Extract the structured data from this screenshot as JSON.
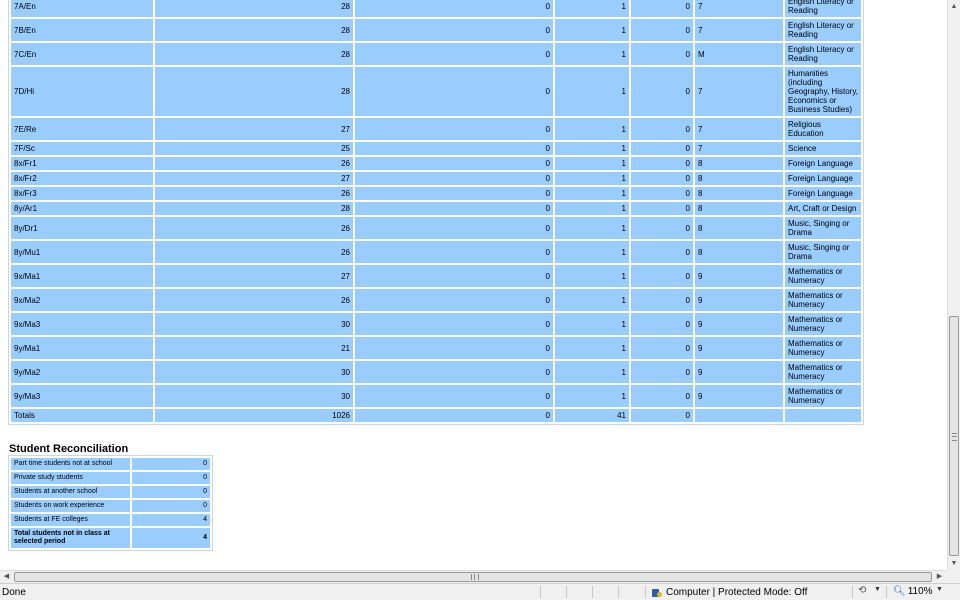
{
  "classes": {
    "rows": [
      {
        "cls": "7A/En",
        "size": "28",
        "c2": "0",
        "c3": "1",
        "c4": "0",
        "year": "7",
        "subject": "English Literacy or Reading"
      },
      {
        "cls": "7B/En",
        "size": "28",
        "c2": "0",
        "c3": "1",
        "c4": "0",
        "year": "7",
        "subject": "English Literacy or Reading"
      },
      {
        "cls": "7C/En",
        "size": "28",
        "c2": "0",
        "c3": "1",
        "c4": "0",
        "year": "M",
        "subject": "English Literacy or Reading"
      },
      {
        "cls": "7D/Hi",
        "size": "28",
        "c2": "0",
        "c3": "1",
        "c4": "0",
        "year": "7",
        "subject": "Humanities (including Geography, History, Economics or Business Studies)"
      },
      {
        "cls": "7E/Re",
        "size": "27",
        "c2": "0",
        "c3": "1",
        "c4": "0",
        "year": "7",
        "subject": "Religious Education"
      },
      {
        "cls": "7F/Sc",
        "size": "25",
        "c2": "0",
        "c3": "1",
        "c4": "0",
        "year": "7",
        "subject": "Science"
      },
      {
        "cls": "8x/Fr1",
        "size": "26",
        "c2": "0",
        "c3": "1",
        "c4": "0",
        "year": "8",
        "subject": "Foreign Language"
      },
      {
        "cls": "8x/Fr2",
        "size": "27",
        "c2": "0",
        "c3": "1",
        "c4": "0",
        "year": "8",
        "subject": "Foreign Language"
      },
      {
        "cls": "8x/Fr3",
        "size": "26",
        "c2": "0",
        "c3": "1",
        "c4": "0",
        "year": "8",
        "subject": "Foreign Language"
      },
      {
        "cls": "8y/Ar1",
        "size": "28",
        "c2": "0",
        "c3": "1",
        "c4": "0",
        "year": "8",
        "subject": "Art, Craft or Design"
      },
      {
        "cls": "8y/Dr1",
        "size": "26",
        "c2": "0",
        "c3": "1",
        "c4": "0",
        "year": "8",
        "subject": "Music, Singing or Drama"
      },
      {
        "cls": "8y/Mu1",
        "size": "26",
        "c2": "0",
        "c3": "1",
        "c4": "0",
        "year": "8",
        "subject": "Music, Singing or Drama"
      },
      {
        "cls": "9x/Ma1",
        "size": "27",
        "c2": "0",
        "c3": "1",
        "c4": "0",
        "year": "9",
        "subject": "Mathematics or Numeracy"
      },
      {
        "cls": "9x/Ma2",
        "size": "26",
        "c2": "0",
        "c3": "1",
        "c4": "0",
        "year": "9",
        "subject": "Mathematics or Numeracy"
      },
      {
        "cls": "9x/Ma3",
        "size": "30",
        "c2": "0",
        "c3": "1",
        "c4": "0",
        "year": "9",
        "subject": "Mathematics or Numeracy"
      },
      {
        "cls": "9y/Ma1",
        "size": "21",
        "c2": "0",
        "c3": "1",
        "c4": "0",
        "year": "9",
        "subject": "Mathematics or Numeracy"
      },
      {
        "cls": "9y/Ma2",
        "size": "30",
        "c2": "0",
        "c3": "1",
        "c4": "0",
        "year": "9",
        "subject": "Mathematics or Numeracy"
      },
      {
        "cls": "9y/Ma3",
        "size": "30",
        "c2": "0",
        "c3": "1",
        "c4": "0",
        "year": "9",
        "subject": "Mathematics or Numeracy"
      }
    ],
    "totals": {
      "label": "Totals",
      "size": "1026",
      "c2": "0",
      "c3": "41",
      "c4": "0",
      "year": "",
      "subject": ""
    }
  },
  "reconciliation": {
    "title": "Student Reconciliation",
    "rows": [
      {
        "label": "Part time students not at school",
        "value": "0"
      },
      {
        "label": "Private study students",
        "value": "0"
      },
      {
        "label": "Students at another school",
        "value": "0"
      },
      {
        "label": "Students on work experience",
        "value": "0"
      },
      {
        "label": "Students at FE colleges",
        "value": "4"
      }
    ],
    "total": {
      "label": "Total students not in class at selected period",
      "value": "4"
    }
  },
  "statusbar": {
    "status": "Done",
    "zone": "Computer | Protected Mode: Off",
    "zoom": "110%"
  },
  "icons": {
    "zone": "computer-shield-icon",
    "popup": "popup-blocker-icon",
    "zoom": "magnifier-icon"
  }
}
